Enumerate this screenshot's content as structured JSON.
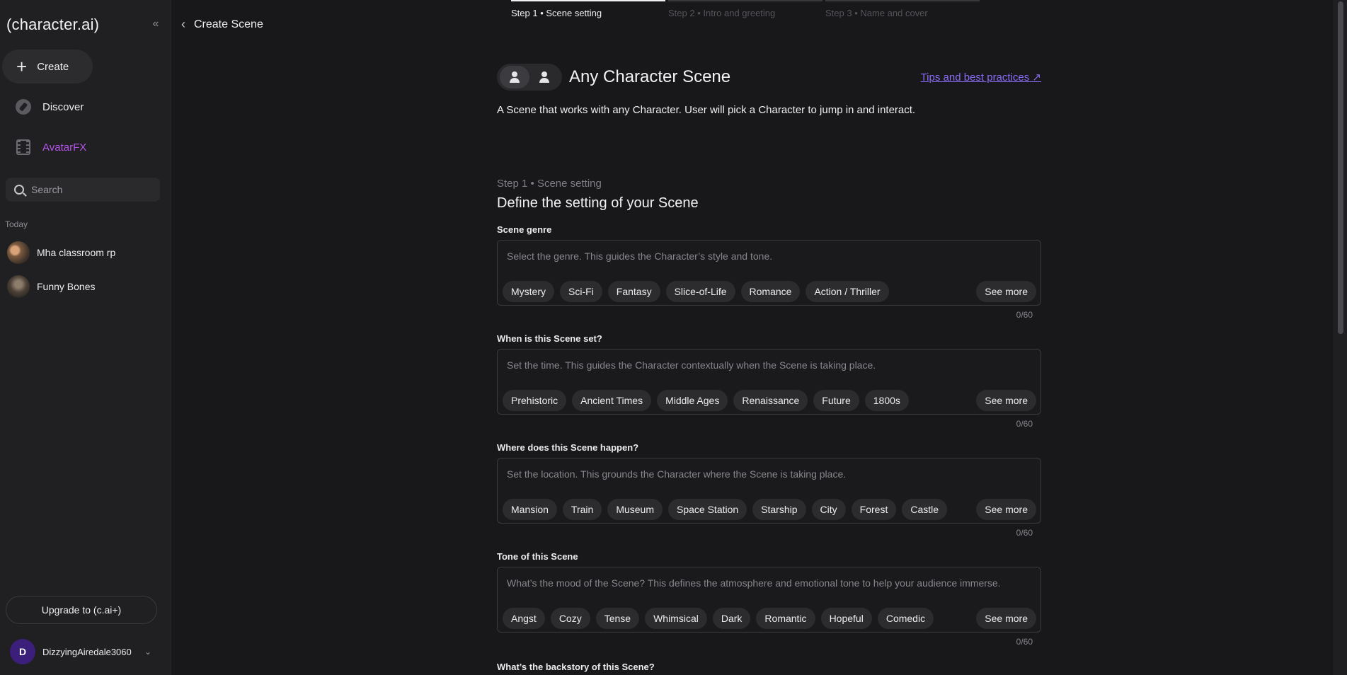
{
  "sidebar": {
    "logo": "(character.ai)",
    "create_label": "Create",
    "discover_label": "Discover",
    "avatarfx_label": "AvatarFX",
    "search_placeholder": "Search",
    "section_today": "Today",
    "chats": [
      {
        "name": "Mha classroom rp"
      },
      {
        "name": "Funny Bones"
      }
    ],
    "upgrade_label": "Upgrade to (c.ai+)",
    "user": {
      "initial": "D",
      "name": "DizzyingAiredale3060"
    }
  },
  "header": {
    "back_title": "Create Scene"
  },
  "steps": [
    {
      "label": "Step 1 • Scene setting"
    },
    {
      "label": "Step 2 • Intro and greeting"
    },
    {
      "label": "Step 3 • Name and cover"
    }
  ],
  "scene": {
    "title": "Any Character Scene",
    "tips_link": "Tips and best practices",
    "description": "A Scene that works with any Character. User will pick a Character to jump in and interact."
  },
  "step_section": {
    "small": "Step 1 • Scene setting",
    "title": "Define the setting of your Scene"
  },
  "fields": [
    {
      "label": "Scene genre",
      "placeholder": "Select the genre. This guides the Character’s style and tone.",
      "chips": [
        "Mystery",
        "Sci-Fi",
        "Fantasy",
        "Slice-of-Life",
        "Romance",
        "Action / Thriller"
      ],
      "see_more": "See more",
      "counter": "0/60"
    },
    {
      "label": "When is this Scene set?",
      "placeholder": "Set the time. This guides the Character contextually when the Scene is taking place.",
      "chips": [
        "Prehistoric",
        "Ancient Times",
        "Middle Ages",
        "Renaissance",
        "Future",
        "1800s"
      ],
      "see_more": "See more",
      "counter": "0/60"
    },
    {
      "label": "Where does this Scene happen?",
      "placeholder": "Set the location. This grounds the Character where the Scene is taking place.",
      "chips": [
        "Mansion",
        "Train",
        "Museum",
        "Space Station",
        "Starship",
        "City",
        "Forest",
        "Castle"
      ],
      "see_more": "See more",
      "counter": "0/60"
    },
    {
      "label": "Tone of this Scene",
      "placeholder": "What’s the mood of the Scene? This defines the atmosphere and emotional tone to help your audience immerse.",
      "chips": [
        "Angst",
        "Cozy",
        "Tense",
        "Whimsical",
        "Dark",
        "Romantic",
        "Hopeful",
        "Comedic"
      ],
      "see_more": "See more",
      "counter": "0/60"
    }
  ],
  "backstory_label": "What’s the backstory of this Scene?"
}
